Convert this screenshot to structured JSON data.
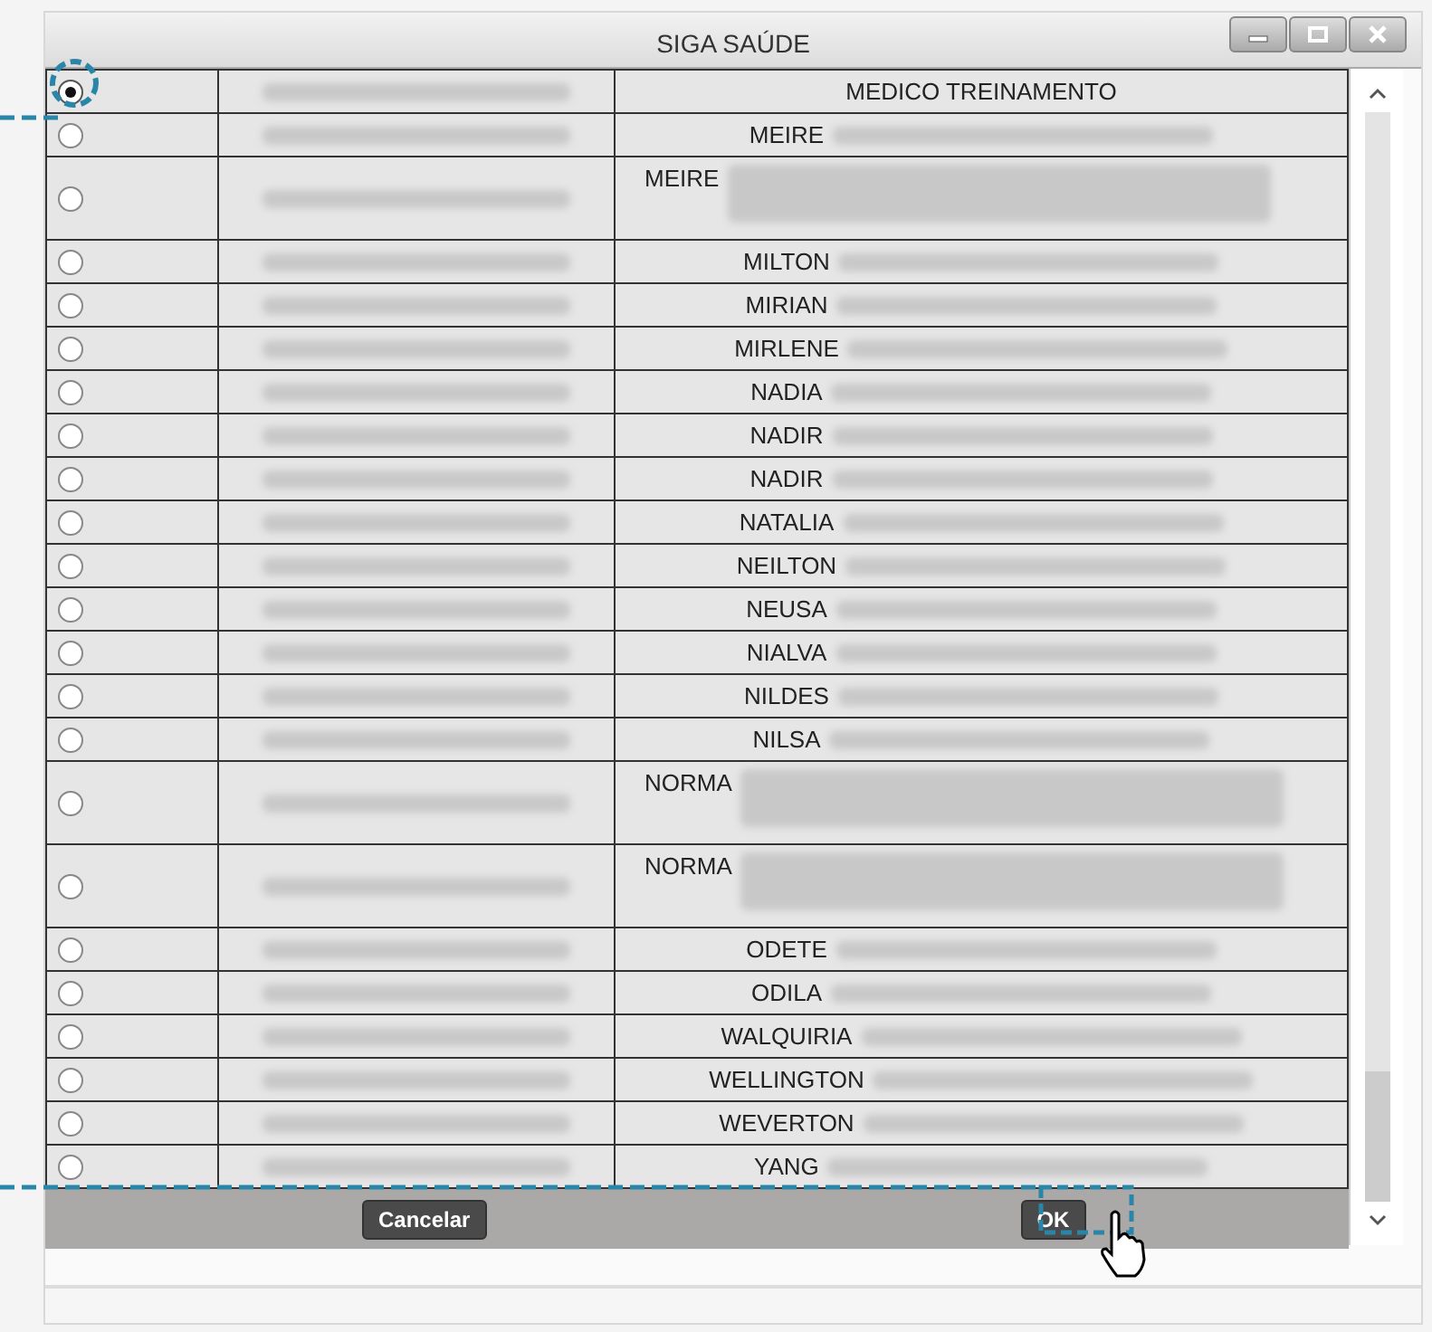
{
  "window": {
    "title": "SIGA SAÚDE"
  },
  "rows": [
    {
      "name": "MEDICO TREINAMENTO",
      "selected": true,
      "kind": "plain"
    },
    {
      "name": "MEIRE",
      "selected": false,
      "kind": "single"
    },
    {
      "name": "MEIRE",
      "selected": false,
      "kind": "double"
    },
    {
      "name": "MILTON",
      "selected": false,
      "kind": "single"
    },
    {
      "name": "MIRIAN",
      "selected": false,
      "kind": "single"
    },
    {
      "name": "MIRLENE",
      "selected": false,
      "kind": "single"
    },
    {
      "name": "NADIA",
      "selected": false,
      "kind": "single"
    },
    {
      "name": "NADIR",
      "selected": false,
      "kind": "single"
    },
    {
      "name": "NADIR",
      "selected": false,
      "kind": "single"
    },
    {
      "name": "NATALIA",
      "selected": false,
      "kind": "single"
    },
    {
      "name": "NEILTON",
      "selected": false,
      "kind": "single"
    },
    {
      "name": "NEUSA",
      "selected": false,
      "kind": "single"
    },
    {
      "name": "NIALVA",
      "selected": false,
      "kind": "single"
    },
    {
      "name": "NILDES",
      "selected": false,
      "kind": "single"
    },
    {
      "name": "NILSA",
      "selected": false,
      "kind": "single"
    },
    {
      "name": "NORMA",
      "selected": false,
      "kind": "double"
    },
    {
      "name": "NORMA",
      "selected": false,
      "kind": "double"
    },
    {
      "name": "ODETE",
      "selected": false,
      "kind": "single"
    },
    {
      "name": "ODILA",
      "selected": false,
      "kind": "single"
    },
    {
      "name": "WALQUIRIA",
      "selected": false,
      "kind": "single"
    },
    {
      "name": "WELLINGTON",
      "selected": false,
      "kind": "single"
    },
    {
      "name": "WEVERTON",
      "selected": false,
      "kind": "single"
    },
    {
      "name": "YANG",
      "selected": false,
      "kind": "single"
    }
  ],
  "buttons": {
    "cancel": "Cancelar",
    "ok": "OK"
  }
}
